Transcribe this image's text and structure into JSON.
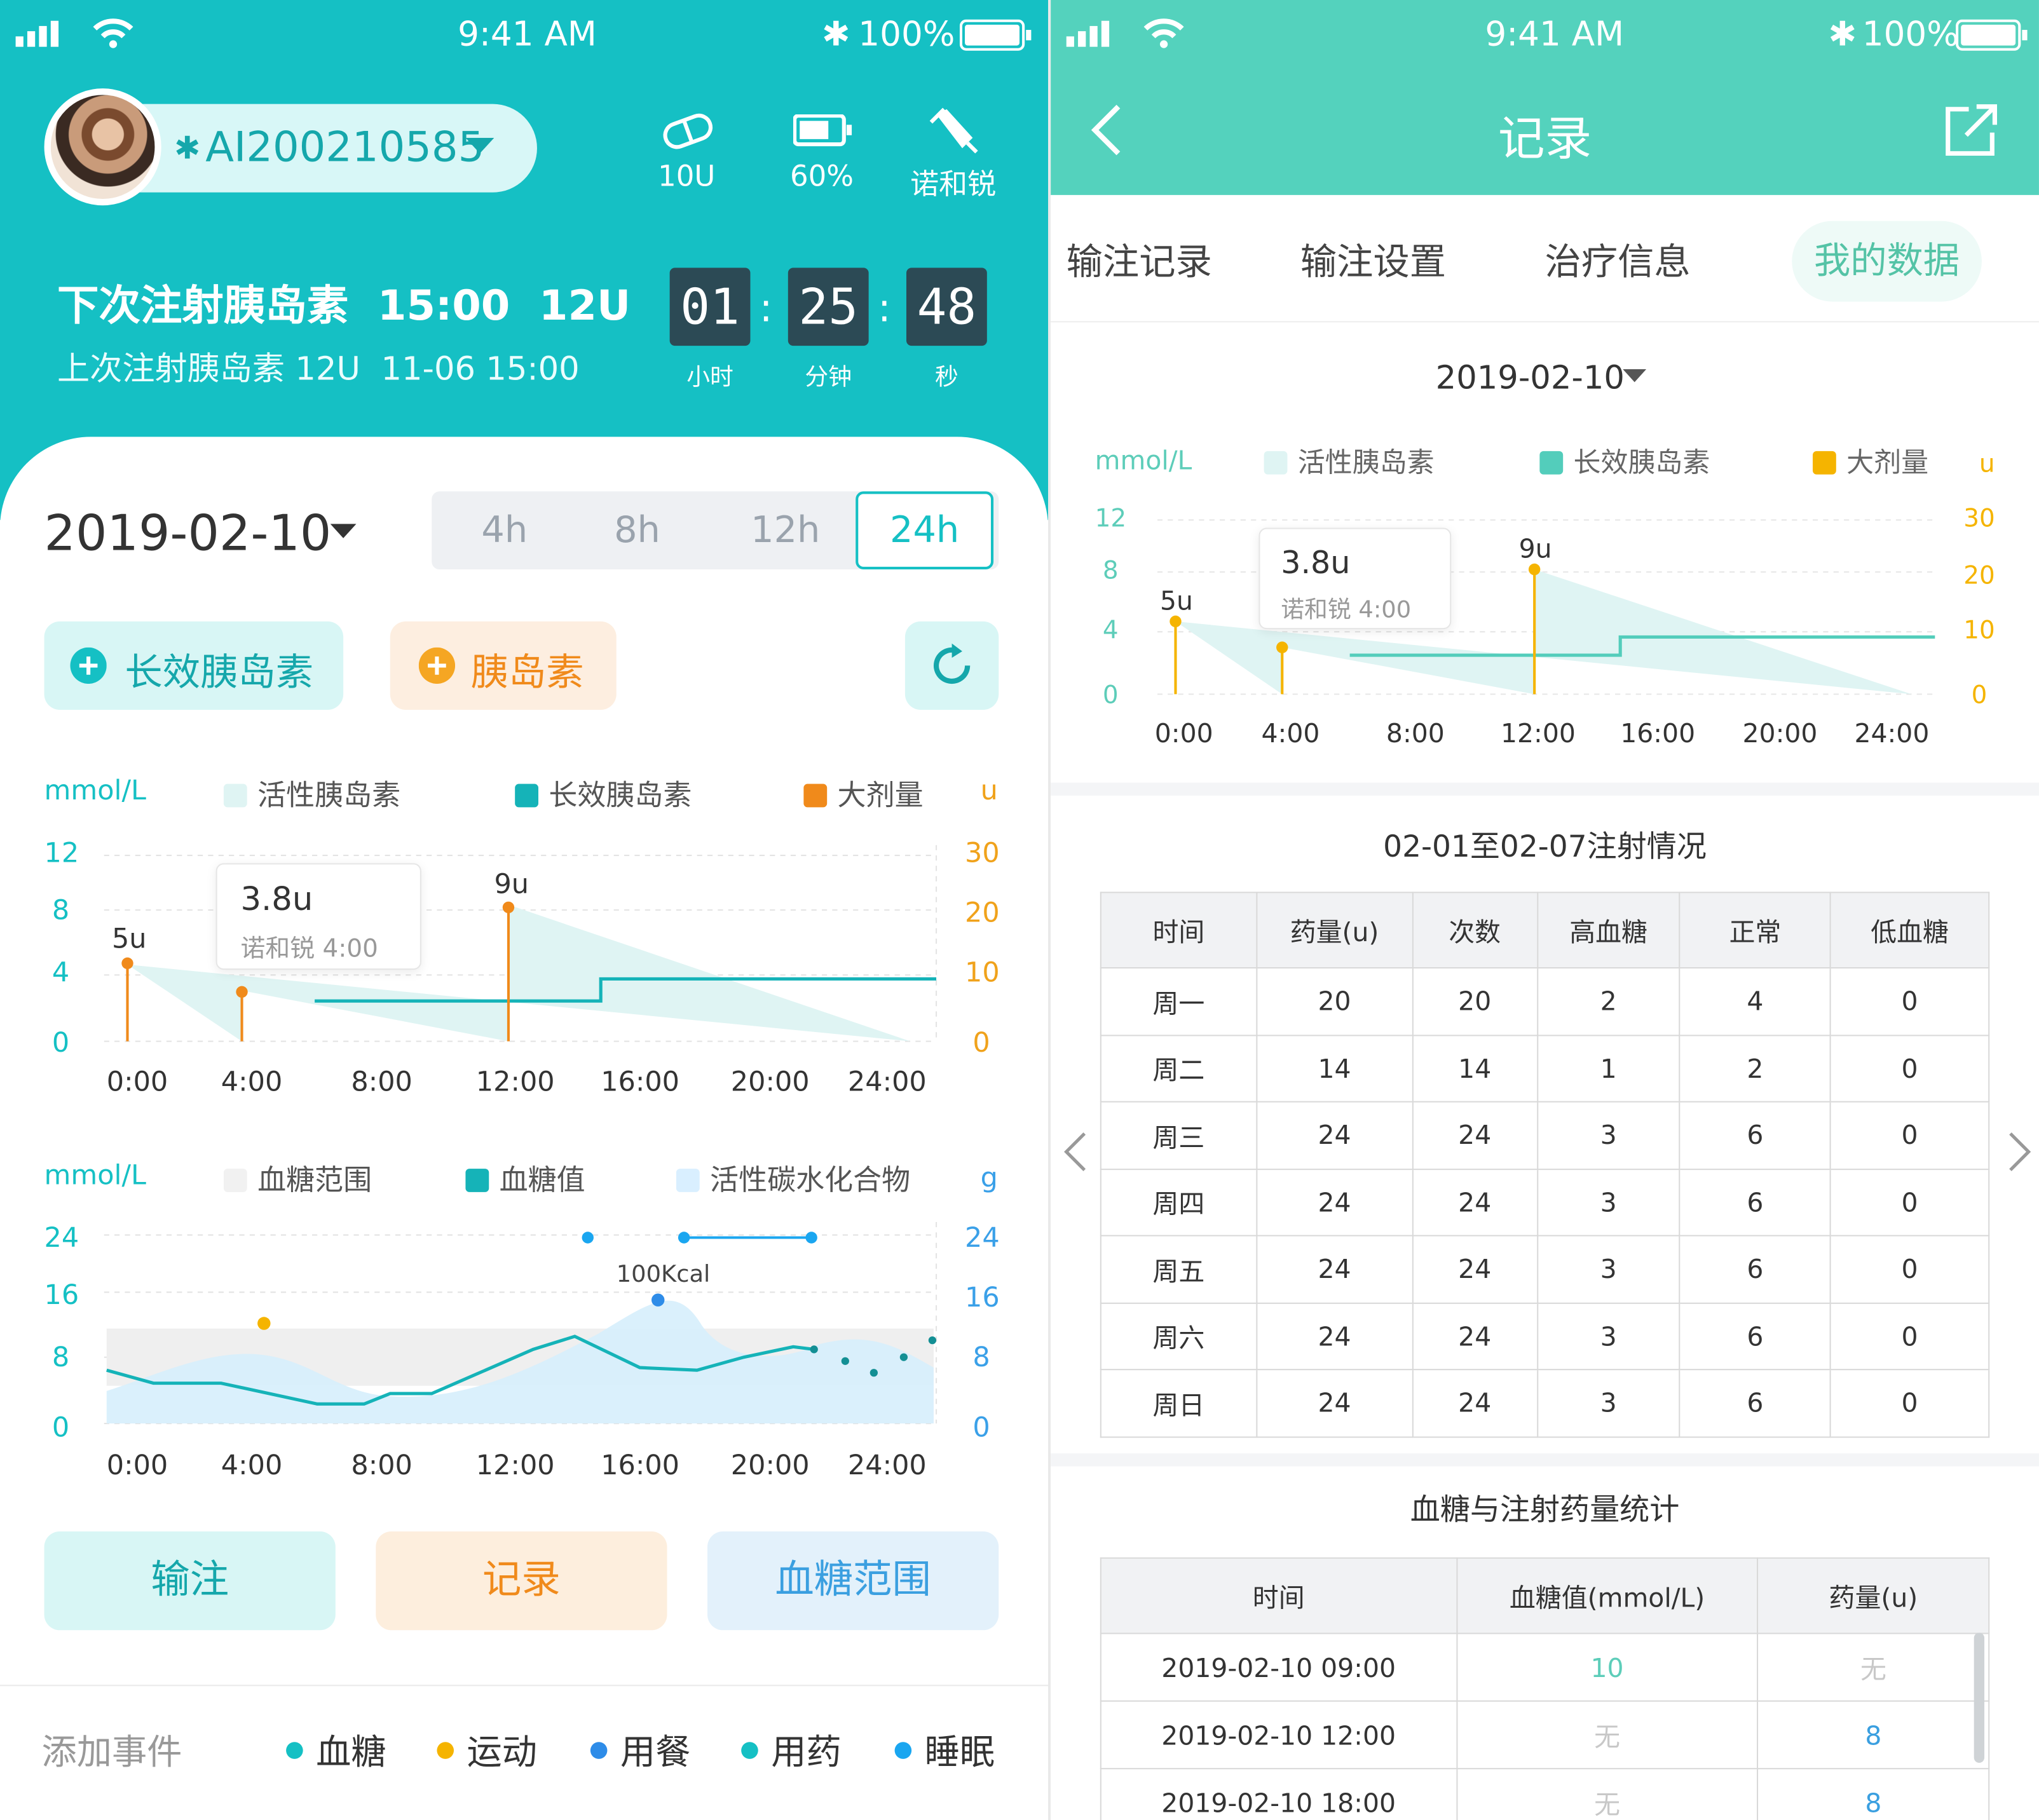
{
  "left": {
    "status": {
      "signal": "signal-icon",
      "time": "9:41 AM",
      "battery": "100%"
    },
    "device": {
      "id": "AI200210585"
    },
    "stats": [
      {
        "icon": "pill-icon",
        "label": "10U"
      },
      {
        "icon": "battery-icon",
        "label": "60%"
      },
      {
        "icon": "syringe-icon",
        "label": "诺和锐"
      }
    ],
    "next_injection": {
      "label": "下次注射胰岛素",
      "time": "15:00",
      "dose": "12U"
    },
    "last_injection": {
      "label": "上次注射胰岛素",
      "dose": "12U",
      "time": "11-06 15:00"
    },
    "countdown": [
      {
        "value": "01",
        "unit": "小时"
      },
      {
        "value": "25",
        "unit": "分钟"
      },
      {
        "value": "48",
        "unit": "秒"
      }
    ],
    "date": "2019-02-10",
    "ranges": [
      "4h",
      "8h",
      "12h",
      "24h"
    ],
    "selected_range": "24h",
    "add_long_insulin": "长效胰岛素",
    "add_insulin": "胰岛素",
    "refresh_icon": "refresh-icon",
    "bottom_buttons": [
      "输注",
      "记录",
      "血糖范围"
    ],
    "events_label": "添加事件",
    "events": [
      {
        "label": "血糖",
        "color": "#15c0c4"
      },
      {
        "label": "运动",
        "color": "#f5b400"
      },
      {
        "label": "用餐",
        "color": "#2e8ce8"
      },
      {
        "label": "用药",
        "color": "#15c0c4"
      },
      {
        "label": "睡眠",
        "color": "#1aa6f0"
      }
    ]
  },
  "right": {
    "status": {
      "time": "9:41 AM",
      "battery": "100%"
    },
    "title": "记录",
    "back_icon": "back-icon",
    "share_icon": "share-icon",
    "tabs": [
      "输注记录",
      "输注设置",
      "治疗信息",
      "我的数据"
    ],
    "active_tab": "我的数据",
    "date": "2019-02-10",
    "weekly_title": "02-01至02-07注射情况",
    "weekly_headers": [
      "时间",
      "药量(u)",
      "次数",
      "高血糖",
      "正常",
      "低血糖"
    ],
    "weekly_rows": [
      [
        "周一",
        "20",
        "20",
        "2",
        "4",
        "0"
      ],
      [
        "周二",
        "14",
        "14",
        "1",
        "2",
        "0"
      ],
      [
        "周三",
        "24",
        "24",
        "3",
        "6",
        "0"
      ],
      [
        "周四",
        "24",
        "24",
        "3",
        "6",
        "0"
      ],
      [
        "周五",
        "24",
        "24",
        "3",
        "6",
        "0"
      ],
      [
        "周六",
        "24",
        "24",
        "3",
        "6",
        "0"
      ],
      [
        "周日",
        "24",
        "24",
        "3",
        "6",
        "0"
      ]
    ],
    "stats_title": "血糖与注射药量统计",
    "stats_headers": [
      "时间",
      "血糖值(mmol/L)",
      "药量(u)"
    ],
    "stats_rows": [
      [
        "2019-02-10  09:00",
        "10",
        "无"
      ],
      [
        "2019-02-10  12:00",
        "无",
        "8"
      ],
      [
        "2019-02-10  18:00",
        "无",
        "8"
      ]
    ]
  },
  "chart_data": [
    {
      "type": "area",
      "title": "",
      "ylabel": "mmol/L",
      "y2label": "u",
      "x_ticks": [
        "0:00",
        "4:00",
        "8:00",
        "12:00",
        "16:00",
        "20:00",
        "24:00"
      ],
      "y_ticks": [
        "12",
        "8",
        "4",
        "0"
      ],
      "y2_ticks": [
        "30",
        "20",
        "10",
        "0"
      ],
      "ylim": [
        0,
        12
      ],
      "y2lim": [
        0,
        30
      ],
      "legend": [
        {
          "name": "活性胰岛素",
          "color": "#dff4f3"
        },
        {
          "name": "长效胰岛素",
          "color": "#15b3b8"
        },
        {
          "name": "大剂量",
          "color": "#f08a1b"
        }
      ],
      "boluses": [
        {
          "x": 0,
          "value": 5,
          "label": "5u"
        },
        {
          "x": 4,
          "value": 3.8,
          "label": ""
        },
        {
          "x": 13,
          "value": 9,
          "label": "9u"
        }
      ],
      "tooltip": {
        "value": "3.8u",
        "drug": "诺和锐",
        "time": "4:00"
      },
      "long_acting_steps": [
        [
          6,
          3
        ],
        [
          16,
          3
        ],
        [
          16,
          4.4
        ],
        [
          28,
          4.4
        ]
      ]
    },
    {
      "type": "line",
      "title": "",
      "ylabel": "mmol/L",
      "y2label": "g",
      "x_ticks": [
        "0:00",
        "4:00",
        "8:00",
        "12:00",
        "16:00",
        "20:00",
        "24:00"
      ],
      "y_ticks": [
        "24",
        "16",
        "8",
        "0"
      ],
      "y2_ticks": [
        "24",
        "16",
        "8",
        "0"
      ],
      "ylim": [
        0,
        24
      ],
      "legend": [
        {
          "name": "血糖范围",
          "color": "#f0f0f0"
        },
        {
          "name": "血糖值",
          "color": "#15b3b8"
        },
        {
          "name": "活性碳水化合物",
          "color": "#d9efff"
        }
      ],
      "glucose_range": [
        4,
        11
      ],
      "glucose": [
        [
          0,
          6.5
        ],
        [
          2,
          5.5
        ],
        [
          4,
          5.5
        ],
        [
          8,
          3.5
        ],
        [
          10,
          3.0
        ],
        [
          11,
          4.5
        ],
        [
          14,
          4.5
        ],
        [
          19,
          10
        ],
        [
          24,
          11
        ],
        [
          28,
          7
        ],
        [
          32,
          8
        ],
        [
          35,
          9
        ],
        [
          38,
          9
        ]
      ],
      "scatter_future": [
        [
          38,
          8.5
        ],
        [
          39.5,
          7.5
        ],
        [
          41,
          6.5
        ],
        [
          43.5,
          7.7
        ],
        [
          44.5,
          9.5
        ]
      ],
      "carbs_label": "100Kcal",
      "events_top": [
        [
          21,
          22
        ],
        [
          25,
          22
        ],
        [
          32,
          22
        ]
      ],
      "exercise": [
        [
          9.5,
          13
        ]
      ]
    },
    {
      "type": "area",
      "title": "",
      "ylabel": "mmol/L",
      "y2label": "u",
      "x_ticks": [
        "0:00",
        "4:00",
        "8:00",
        "12:00",
        "16:00",
        "20:00",
        "24:00"
      ],
      "y_ticks": [
        "12",
        "8",
        "4",
        "0"
      ],
      "y2_ticks": [
        "30",
        "20",
        "10",
        "0"
      ],
      "legend": [
        {
          "name": "活性胰岛素",
          "color": "#dff4f3"
        },
        {
          "name": "长效胰岛素",
          "color": "#53cdbb"
        },
        {
          "name": "大剂量",
          "color": "#f5b400"
        }
      ],
      "boluses": [
        {
          "x": 0,
          "value": 5,
          "label": "5u"
        },
        {
          "x": 4,
          "value": 3.8,
          "label": ""
        },
        {
          "x": 13,
          "value": 9,
          "label": "9u"
        }
      ],
      "tooltip": {
        "value": "3.8u",
        "drug": "诺和锐",
        "time": "4:00"
      }
    }
  ]
}
